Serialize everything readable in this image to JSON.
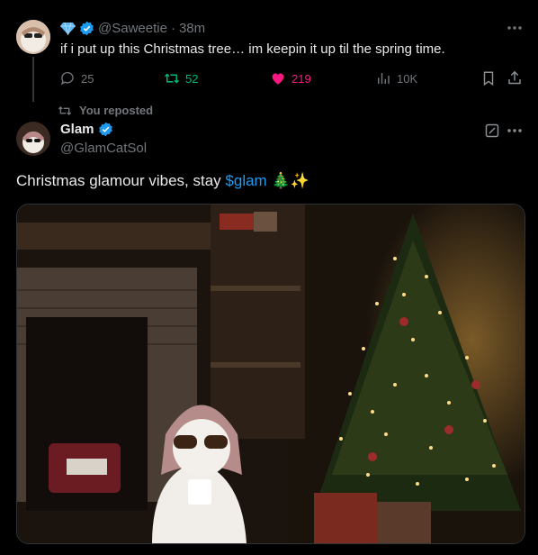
{
  "tweet1": {
    "handle": "@Saweetie",
    "separator": "·",
    "time": "38m",
    "text": "if i put up this Christmas tree… im keepin it up til the spring time.",
    "actions": {
      "replies": "25",
      "reposts": "52",
      "likes": "219",
      "views": "10K"
    },
    "colors": {
      "repost": "#00ba7c",
      "like": "#f91880",
      "verified": "#1d9bf0"
    }
  },
  "repost_label": "You reposted",
  "tweet2": {
    "name": "Glam",
    "handle": "@GlamCatSol",
    "text_prefix": "Christmas glamour vibes, stay ",
    "cashtag": "$glam",
    "emoji": "🎄✨",
    "image_icon": "christmas-cat-photo"
  }
}
